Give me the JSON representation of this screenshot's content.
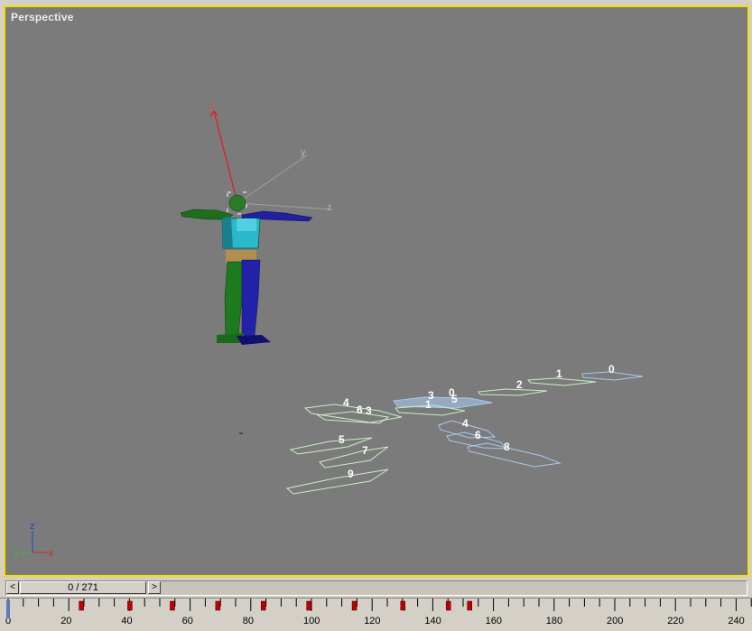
{
  "viewport": {
    "label": "Perspective",
    "border_color": "#f5e000",
    "background": "#7b7b7b"
  },
  "gizmo": {
    "x_label": "x",
    "y_label": "y",
    "z_label": "z"
  },
  "world_axes": {
    "x_label": "x",
    "y_label": "y",
    "z_label": "z"
  },
  "footsteps": {
    "left_color": "#c8f0c0",
    "right_color": "#a8c8f0",
    "labels": [
      "0",
      "1",
      "2",
      "3",
      "0",
      "1",
      "5",
      "4",
      "6",
      "3",
      "4",
      "6",
      "5",
      "7",
      "8",
      "9"
    ]
  },
  "time_slider": {
    "position": "0 / 271",
    "current_frame": 0,
    "total_frames": 271,
    "prev_arrow": "<",
    "next_arrow": ">"
  },
  "trackbar": {
    "tick_labels": [
      "0",
      "20",
      "40",
      "60",
      "80",
      "100",
      "120",
      "140",
      "160",
      "180",
      "200",
      "220",
      "240"
    ],
    "key_color": "#c00000"
  }
}
